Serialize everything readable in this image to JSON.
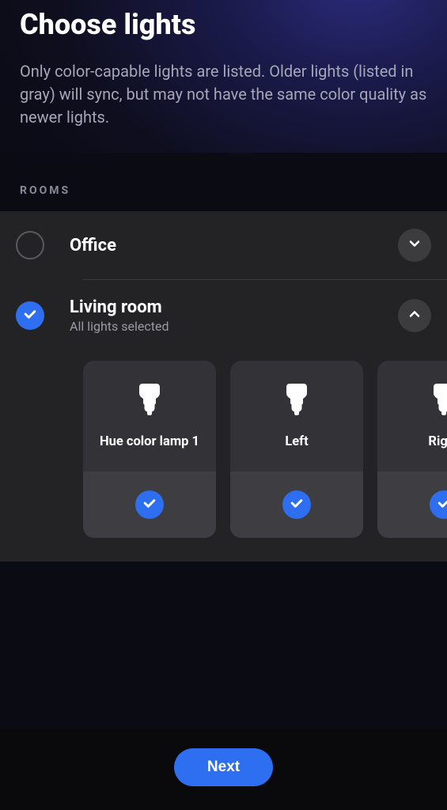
{
  "header": {
    "title": "Choose lights",
    "subtitle": "Only color-capable lights are listed. Older lights (listed in gray) will sync, but may not have the same color quality as newer lights."
  },
  "section_label": "ROOMS",
  "rooms": [
    {
      "name": "Office",
      "selected": false,
      "expanded": false,
      "subtitle": ""
    },
    {
      "name": "Living room",
      "selected": true,
      "expanded": true,
      "subtitle": "All lights selected",
      "lights": [
        {
          "name": "Hue color lamp 1",
          "selected": true
        },
        {
          "name": "Left",
          "selected": true
        },
        {
          "name": "Right",
          "selected": true
        }
      ]
    }
  ],
  "footer": {
    "next_label": "Next"
  },
  "colors": {
    "accent": "#2d6ff0"
  }
}
